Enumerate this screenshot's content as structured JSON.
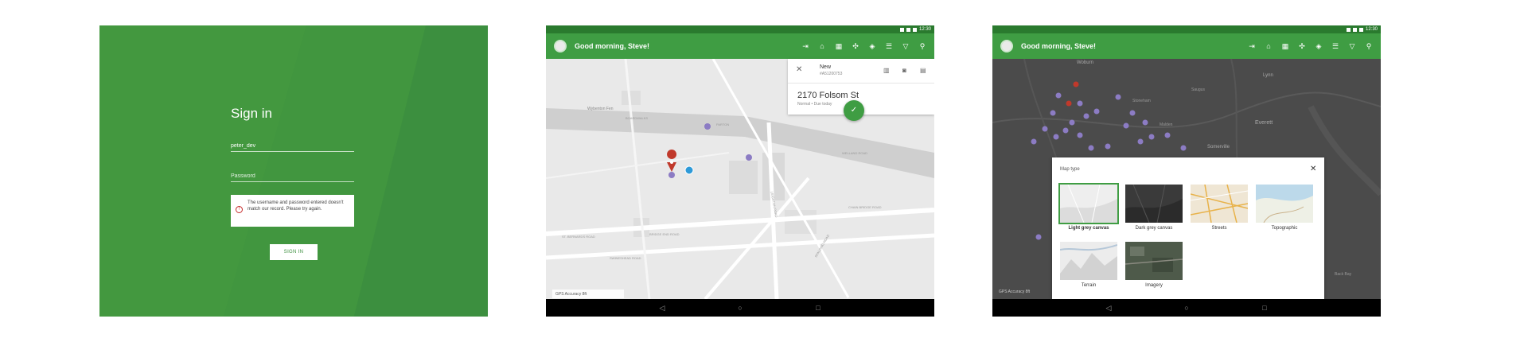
{
  "signin": {
    "title": "Sign in",
    "username_value": "peter_dev",
    "password_placeholder": "Password",
    "error_message": "The username and password entered doesn't match our record. Please try again.",
    "button_label": "SIGN IN"
  },
  "status": {
    "time": "12:30"
  },
  "appbar": {
    "greeting": "Good morning, Steve!",
    "tool_icons": [
      "logout-icon",
      "home-icon",
      "apps-icon",
      "nearby-icon",
      "layers-icon",
      "list-icon",
      "filter-icon",
      "search-icon"
    ]
  },
  "navbar": {
    "back": "◁",
    "home": "○",
    "recents": "□"
  },
  "map2": {
    "labels": [
      "Wybenton Fen",
      "BOARDWALKS",
      "PARTON",
      "WELLAND ROAD",
      "LEIGHTON ROAD",
      "CHAIN BRIDGE ROAD",
      "ST. BERNARDS ROAD",
      "BRIDGE END ROAD",
      "SWINESHEAD ROAD",
      "SPALDING ROAD"
    ],
    "card": {
      "status": "New",
      "id": "#A51200753",
      "address": "2170 Folsom St",
      "subtitle": "Normal  •  Due today"
    },
    "gps_text": "GPS Accuracy 8ft"
  },
  "map3": {
    "labels": [
      "Woburn",
      "Lynn",
      "Everett",
      "Somerville",
      "Stoneham",
      "Malden",
      "Saugus",
      "Back Bay"
    ],
    "dialog": {
      "title": "Map type",
      "options": [
        {
          "label": "Light grey canvas",
          "selected": true
        },
        {
          "label": "Dark grey canvas",
          "selected": false
        },
        {
          "label": "Streets",
          "selected": false
        },
        {
          "label": "Topographic",
          "selected": false
        },
        {
          "label": "Terrain",
          "selected": false
        },
        {
          "label": "Imagery",
          "selected": false
        }
      ]
    },
    "gps_text": "GPS Accuracy 8ft"
  },
  "colors": {
    "primary": "#3f9d43",
    "primary_dark": "#2a7a2e",
    "marker_purple": "#8c7cc4",
    "marker_red": "#c0392b",
    "location_blue": "#2e9ad8"
  }
}
